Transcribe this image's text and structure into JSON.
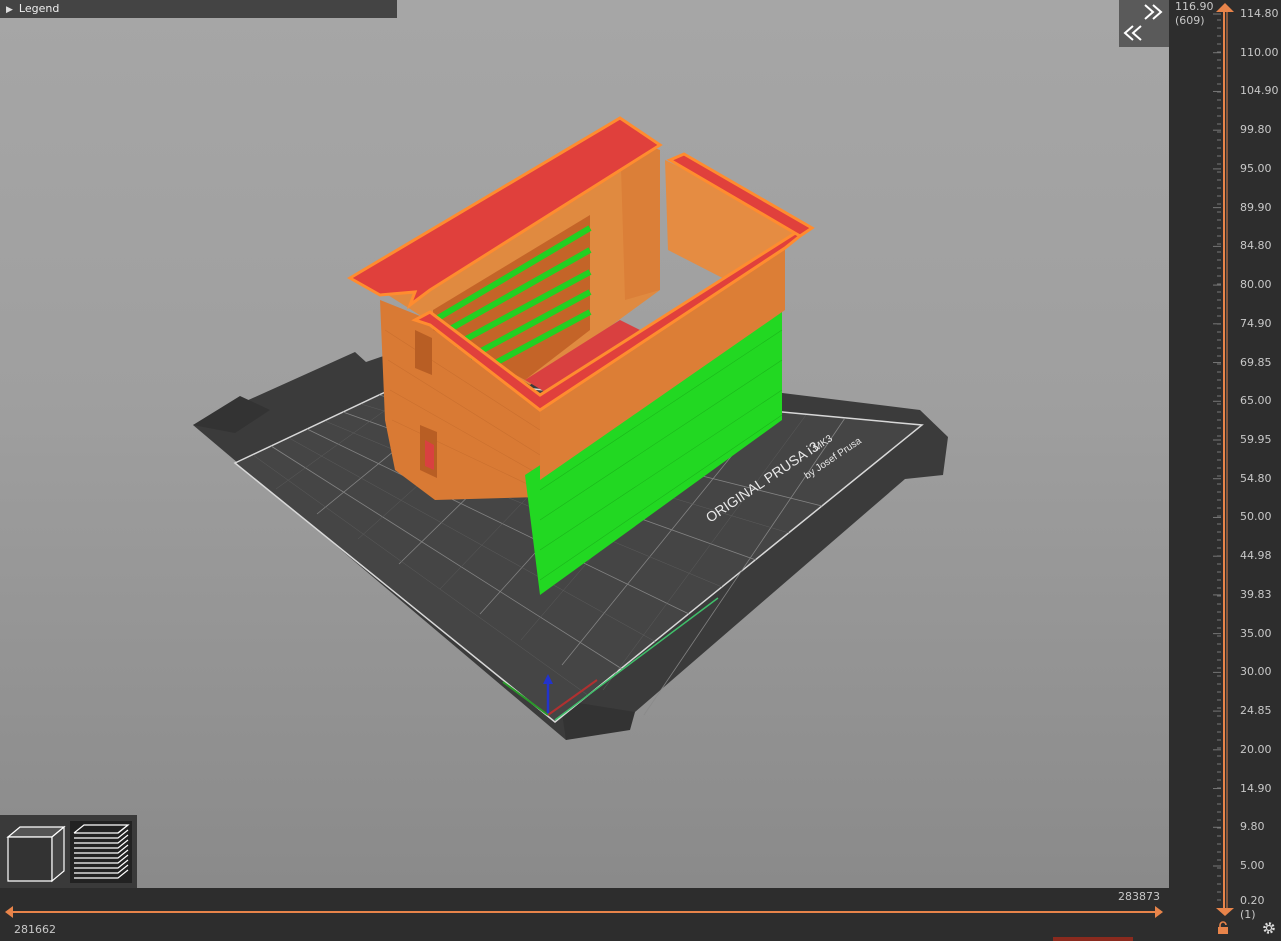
{
  "legend": {
    "label": "Legend"
  },
  "bed": {
    "brand_line": "ORIGINAL PRUSA i3",
    "model": "MK3",
    "byline": "by Josef Prusa"
  },
  "vertical_slider": {
    "top_value": "116.90",
    "top_layer": "(609)",
    "bottom_value": "0.20",
    "bottom_layer": "(1)",
    "ticks": [
      "114.80",
      "110.00",
      "104.90",
      "99.80",
      "95.00",
      "89.90",
      "84.80",
      "80.00",
      "74.90",
      "69.85",
      "65.00",
      "59.95",
      "54.80",
      "50.00",
      "44.98",
      "39.83",
      "35.00",
      "30.00",
      "24.85",
      "20.00",
      "14.90",
      "9.80",
      "5.00"
    ]
  },
  "horizontal_slider": {
    "left_value": "281662",
    "right_value": "283873"
  },
  "colors": {
    "accent": "#e8844a",
    "perimeter": "#ff8c2f",
    "infill": "#d94040",
    "support": "#22e022",
    "bed": "#3b3b3b",
    "panel": "#2d2d2d"
  },
  "icons": [
    "collapse-sidebar-icon",
    "3d-view-icon",
    "preview-layers-icon",
    "lock-icon",
    "gear-icon"
  ]
}
